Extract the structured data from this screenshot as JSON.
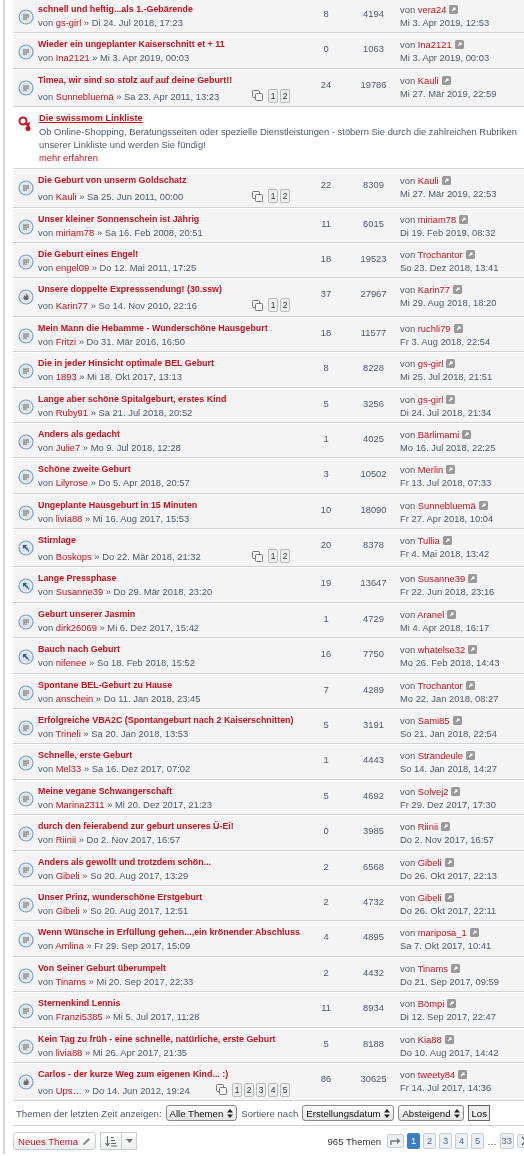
{
  "topics": [
    {
      "kind": "topic",
      "title": "schnell und heftig...als 1.-Gebärende",
      "by": "von",
      "author": "gs-girl",
      "date": "» Di 24. Jul 2018, 17:23",
      "replies": "8",
      "views": "4194",
      "last_by": "von",
      "last_author": "vera24",
      "last_date": "Mi 3. Apr 2019, 12:53"
    },
    {
      "kind": "topic",
      "title": "Wieder ein ungeplanter Kaiserschnitt et + 11",
      "by": "von",
      "author": "Ina2121",
      "date": "» Mi 3. Apr 2019, 00:03",
      "replies": "0",
      "views": "1063",
      "last_by": "von",
      "last_author": "Ina2121",
      "last_date": "Mi 3. Apr 2019, 00:03"
    },
    {
      "kind": "topic",
      "title": "Timea, wir sind so stolz auf auf deine Geburt!!",
      "by": "von",
      "author": "Sunnebluemä",
      "date": "» Sa 23. Apr 2011, 13:23",
      "pages": [
        "1",
        "2"
      ],
      "replies": "24",
      "views": "19786",
      "last_by": "von",
      "last_author": "Kauli",
      "last_date": "Mi 27. Mär 2019, 22:59"
    },
    {
      "kind": "ad",
      "title": "Die swissmom Linkliste",
      "text": "Ob Online-Shopping, Beratungsseiten oder spezielle Dienstleistungen - stöbern Sie durch die zahlreichen Rubriken unserer Linkliste und werden Sie fündig!",
      "link": "mehr erfahren"
    },
    {
      "kind": "topic",
      "title": "Die Geburt von unserm Goldschatz",
      "by": "von",
      "author": "Kauli",
      "date": "» Sa 25. Jun 2011, 00:00",
      "pages": [
        "1",
        "2"
      ],
      "replies": "22",
      "views": "8309",
      "last_by": "von",
      "last_author": "Kauli",
      "last_date": "Mi 27. Mär 2019, 22:53"
    },
    {
      "kind": "topic",
      "title": "Unser kleiner Sonnenschein ist Jährig",
      "by": "von",
      "author": "miriam78",
      "date": "» Sa 16. Feb 2008, 20:51",
      "replies": "11",
      "views": "6015",
      "last_by": "von",
      "last_author": "miriam78",
      "last_date": "Di 19. Feb 2019, 08:32"
    },
    {
      "kind": "topic",
      "title": "Die Geburt eines Engel!",
      "by": "von",
      "author": "engel09",
      "date": "» Do 12. Mai 2011, 17:25",
      "replies": "18",
      "views": "19523",
      "last_by": "von",
      "last_author": "Trochantor",
      "last_date": "So 23. Dez 2018, 13:41"
    },
    {
      "kind": "hot_topic",
      "title": "Unsere doppelte Expresssendung! (30.ssw)",
      "by": "von",
      "author": "Karin77",
      "date": "» So 14. Nov 2010, 22:16",
      "pages": [
        "1",
        "2"
      ],
      "replies": "37",
      "views": "27967",
      "last_by": "von",
      "last_author": "Karin77",
      "last_date": "Mi 29. Aug 2018, 18:20"
    },
    {
      "kind": "topic",
      "title": "Mein Mann die Hebamme - Wunderschöne Hausgeburt",
      "by": "von",
      "author": "Fritzi",
      "date": "» Do 31. Mär 2016, 16:50",
      "replies": "18",
      "views": "11577",
      "last_by": "von",
      "last_author": "ruchli79",
      "last_date": "Fr 3. Aug 2018, 22:54"
    },
    {
      "kind": "topic",
      "title": "Die in jeder Hinsicht optimale BEL Geburt",
      "by": "von",
      "author": "1893",
      "date": "» Mi 18. Okt 2017, 13:13",
      "replies": "8",
      "views": "8228",
      "last_by": "von",
      "last_author": "gs-girl",
      "last_date": "Mi 25. Jul 2018, 21:51"
    },
    {
      "kind": "topic",
      "title": "Lange aber schöne Spitalgeburt, erstes Kind",
      "by": "von",
      "author": "Ruby91",
      "date": "» Sa 21. Jul 2018, 20:52",
      "replies": "5",
      "views": "3256",
      "last_by": "von",
      "last_author": "gs-girl",
      "last_date": "Di 24. Jul 2018, 21:34"
    },
    {
      "kind": "topic",
      "title": "Anders als gedacht",
      "by": "von",
      "author": "Julie7",
      "date": "» Mo 9. Jul 2018, 12:28",
      "replies": "1",
      "views": "4025",
      "last_by": "von",
      "last_author": "Bärlimami",
      "last_date": "Mo 16. Jul 2018, 22:25"
    },
    {
      "kind": "topic",
      "title": "Schöne zweite Geburt",
      "by": "von",
      "author": "Lilyrose",
      "date": "» Do 5. Apr 2018, 20:57",
      "replies": "3",
      "views": "10502",
      "last_by": "von",
      "last_author": "Merlin",
      "last_date": "Fr 13. Jul 2018, 07:33"
    },
    {
      "kind": "topic",
      "title": "Ungeplante Hausgeburt in 15 Minuten",
      "by": "von",
      "author": "livia88",
      "date": "» Mi 16. Aug 2017, 15:53",
      "replies": "10",
      "views": "18090",
      "last_by": "von",
      "last_author": "Sunnebluemä",
      "last_date": "Fr 27. Apr 2018, 10:04"
    },
    {
      "kind": "moved_topic",
      "title": "Stirnlage",
      "by": "von",
      "author": "Boskops",
      "date": "» Do 22. Mär 2018, 21:32",
      "pages": [
        "1",
        "2"
      ],
      "replies": "20",
      "views": "8378",
      "last_by": "von",
      "last_author": "Tullia",
      "last_date": "Fr 4. Mai 2018, 13:42"
    },
    {
      "kind": "moved_topic",
      "title": "Lange Pressphase",
      "by": "von",
      "author": "Susanne39",
      "date": "» Do 29. Mär 2018, 23:20",
      "replies": "19",
      "views": "13647",
      "last_by": "von",
      "last_author": "Susanne39",
      "last_date": "Fr 22. Jun 2018, 23:16"
    },
    {
      "kind": "topic",
      "title": "Geburt unserer Jasmin",
      "by": "von",
      "author": "dirk26069",
      "date": "» Mi 6. Dez 2017, 15:42",
      "replies": "1",
      "views": "4729",
      "last_by": "von",
      "last_author": "Aranel",
      "last_date": "Mi 4. Apr 2018, 16:17"
    },
    {
      "kind": "moved_topic",
      "title": "Bauch nach Geburt",
      "by": "von",
      "author": "nifenee",
      "date": "» So 18. Feb 2018, 15:52",
      "replies": "16",
      "views": "7750",
      "last_by": "von",
      "last_author": "whatelse32",
      "last_date": "Mo 26. Feb 2018, 14:43"
    },
    {
      "kind": "topic",
      "title": "Spontane BEL-Geburt zu Hause",
      "by": "von",
      "author": "anschein",
      "date": "» Do 11. Jan 2018, 23:45",
      "replies": "7",
      "views": "4289",
      "last_by": "von",
      "last_author": "Trochantor",
      "last_date": "Mo 22. Jan 2018, 08:27"
    },
    {
      "kind": "topic",
      "title": "Erfolgreiche VBA2C (Spontangeburt nach 2 Kaiserschnitten)",
      "by": "von",
      "author": "Trineli",
      "date": "» Sa 20. Jan 2018, 13:53",
      "replies": "5",
      "views": "3191",
      "last_by": "von",
      "last_author": "Sami85",
      "last_date": "So 21. Jan 2018, 22:54"
    },
    {
      "kind": "topic",
      "title": "Schnelle, erste Geburt",
      "by": "von",
      "author": "Mel33",
      "date": "» Sa 16. Dez 2017, 07:02",
      "replies": "1",
      "views": "4443",
      "last_by": "von",
      "last_author": "Strandeule",
      "last_date": "So 14. Jan 2018, 14:27"
    },
    {
      "kind": "topic",
      "title": "Meine vegane Schwangerschaft",
      "by": "von",
      "author": "Marina2311",
      "date": "» Mi 20. Dez 2017, 21:23",
      "replies": "5",
      "views": "4692",
      "last_by": "von",
      "last_author": "Solvej2",
      "last_date": "Fr 29. Dez 2017, 17:30"
    },
    {
      "kind": "topic",
      "title": "durch den feierabend zur geburt unseres Ü-Ei!",
      "by": "von",
      "author": "Riinii",
      "date": "» Do 2. Nov 2017, 16:57",
      "replies": "0",
      "views": "3985",
      "last_by": "von",
      "last_author": "Riinii",
      "last_date": "Do 2. Nov 2017, 16:57"
    },
    {
      "kind": "topic",
      "title": "Anders als gewollt und trotzdem schön...",
      "by": "von",
      "author": "Gibeli",
      "date": "» So 20. Aug 2017, 13:29",
      "replies": "2",
      "views": "6568",
      "last_by": "von",
      "last_author": "Gibeli",
      "last_date": "Do 26. Okt 2017, 22:13"
    },
    {
      "kind": "topic",
      "title": "Unser Prinz, wunderschöne Erstgeburt",
      "by": "von",
      "author": "Gibeli",
      "date": "» So 20. Aug 2017, 12:51",
      "replies": "2",
      "views": "4732",
      "last_by": "von",
      "last_author": "Gibeli",
      "last_date": "Do 26. Okt 2017, 22:11"
    },
    {
      "kind": "topic",
      "title": "Wenn Wünsche in Erfüllung gehen...,ein krönender Abschluss",
      "by": "von",
      "author": "Amlina",
      "date": "» Fr 29. Sep 2017, 15:09",
      "replies": "4",
      "views": "4895",
      "last_by": "von",
      "last_author": "mariposa_1",
      "last_date": "Sa 7. Okt 2017, 10:41"
    },
    {
      "kind": "topic",
      "title": "Von Seiner Geburt überumpelt",
      "by": "von",
      "author": "Tinams",
      "date": "» Mi 20. Sep 2017, 22:33",
      "replies": "2",
      "views": "4432",
      "last_by": "von",
      "last_author": "Tinams",
      "last_date": "Do 21. Sep 2017, 09:59"
    },
    {
      "kind": "topic",
      "title": "Sternenkind Lennis",
      "by": "von",
      "author": "Franzi5385",
      "date": "» Mi 5. Jul 2017, 11:28",
      "replies": "11",
      "views": "8934",
      "last_by": "von",
      "last_author": "Bömpi",
      "last_date": "Di 12. Sep 2017, 22:47"
    },
    {
      "kind": "topic",
      "title": "Kein Tag zu früh - eine schnelle, natürliche, erste Geburt",
      "by": "von",
      "author": "livia88",
      "date": "» Mi 26. Apr 2017, 21:35",
      "replies": "5",
      "views": "8188",
      "last_by": "von",
      "last_author": "Kia88",
      "last_date": "Do 10. Aug 2017, 14:42"
    },
    {
      "kind": "hot_topic",
      "title": "Carlos - der kurze Weg zum eigenen Kind... :)",
      "by": "von",
      "author": "Ups…",
      "date": "» Do 14. Jun 2012, 19:24",
      "pages": [
        "1",
        "2",
        "3",
        "4",
        "5"
      ],
      "replies": "86",
      "views": "30625",
      "last_by": "von",
      "last_author": "tweety84",
      "last_date": "Fr 14. Jul 2017, 14:36"
    }
  ],
  "filter": {
    "label": "Themen der letzten Zeit anzeigen:",
    "period": "Alle Themen",
    "sort_label": "Sortiere nach",
    "sort_key": "Erstellungsdatum",
    "sort_order": "Absteigend",
    "go": "Los"
  },
  "footer": {
    "new_topic": "Neues Thema",
    "count": "965 Themen",
    "pages": [
      {
        "label": "1",
        "selected": true
      },
      {
        "label": "2",
        "selected": false
      },
      {
        "label": "3",
        "selected": false
      },
      {
        "label": "4",
        "selected": false
      },
      {
        "label": "5",
        "selected": false
      },
      {
        "label": "…",
        "kind": "gap"
      },
      {
        "label": "33",
        "selected": false
      }
    ]
  }
}
